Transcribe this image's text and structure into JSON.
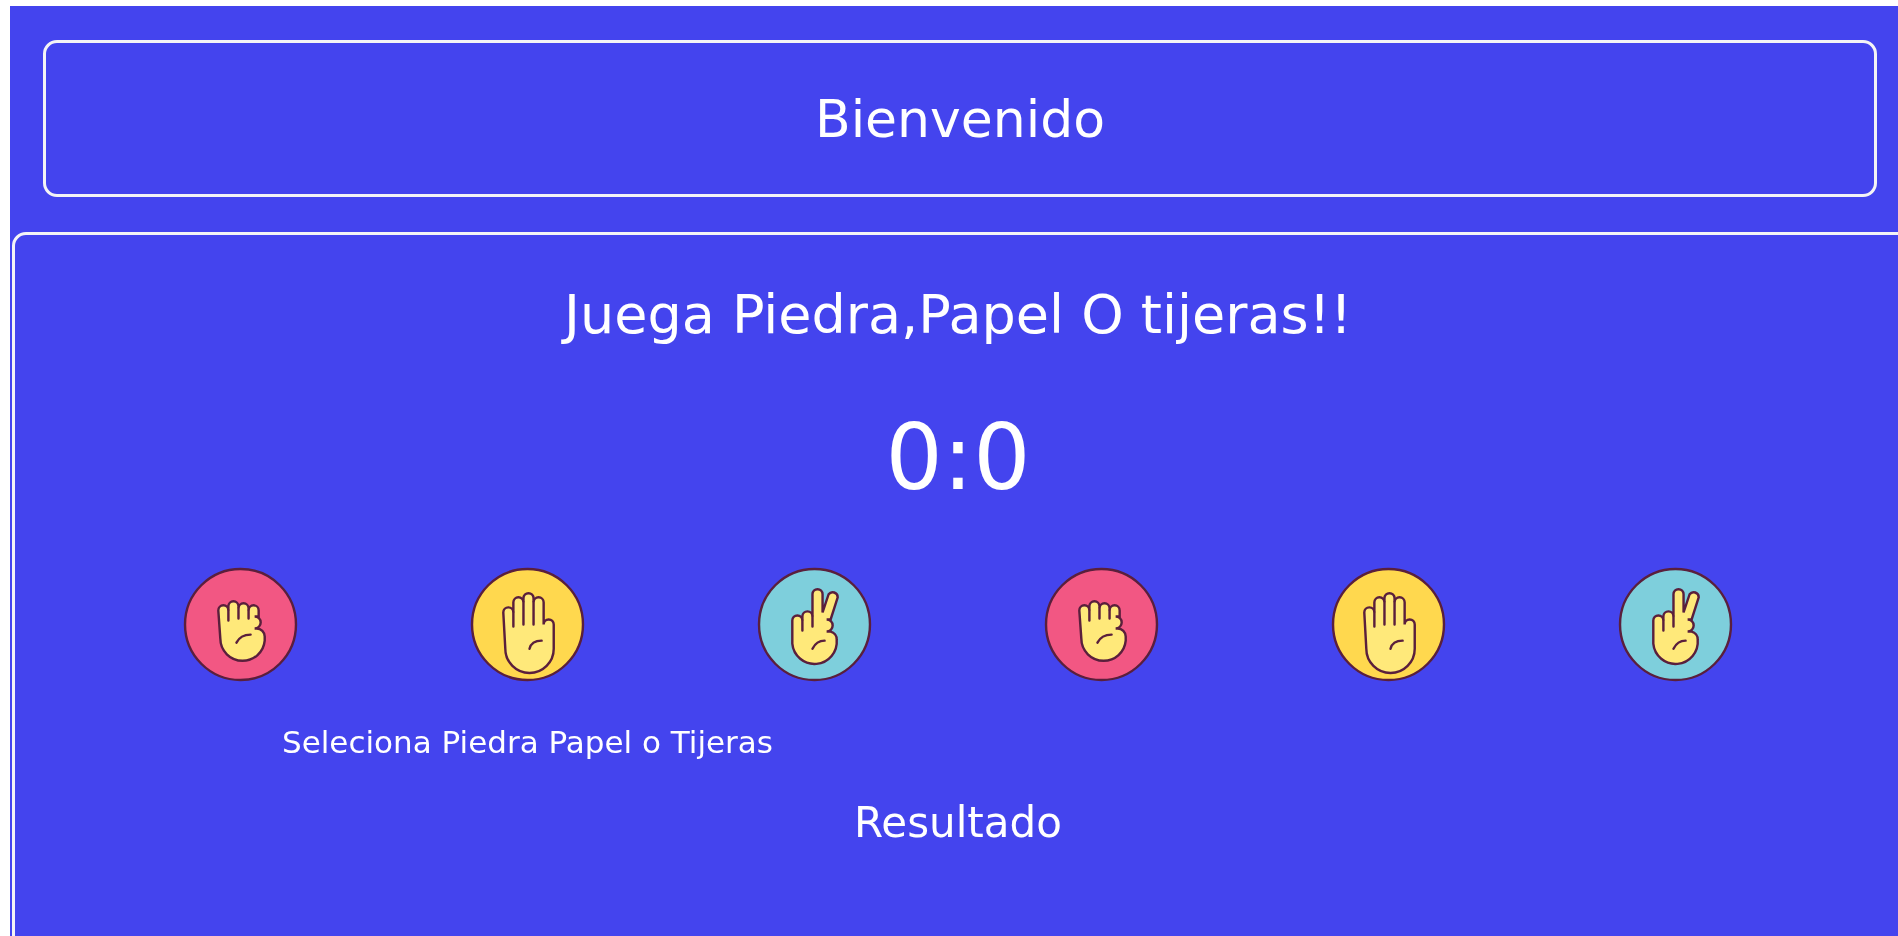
{
  "header": {
    "title": "Bienvenido"
  },
  "game": {
    "title": "Juega Piedra,Papel O tijeras!!",
    "score": "0:0",
    "choices": [
      {
        "kind": "rock",
        "color": "#f25783"
      },
      {
        "kind": "paper",
        "color": "#ffd84e"
      },
      {
        "kind": "scissors",
        "color": "#7ecfdc"
      },
      {
        "kind": "rock",
        "color": "#f25783"
      },
      {
        "kind": "paper",
        "color": "#ffd84e"
      },
      {
        "kind": "scissors",
        "color": "#7ecfdc"
      }
    ],
    "prompt": "Seleciona Piedra Papel o Tijeras",
    "result_label": "Resultado"
  }
}
